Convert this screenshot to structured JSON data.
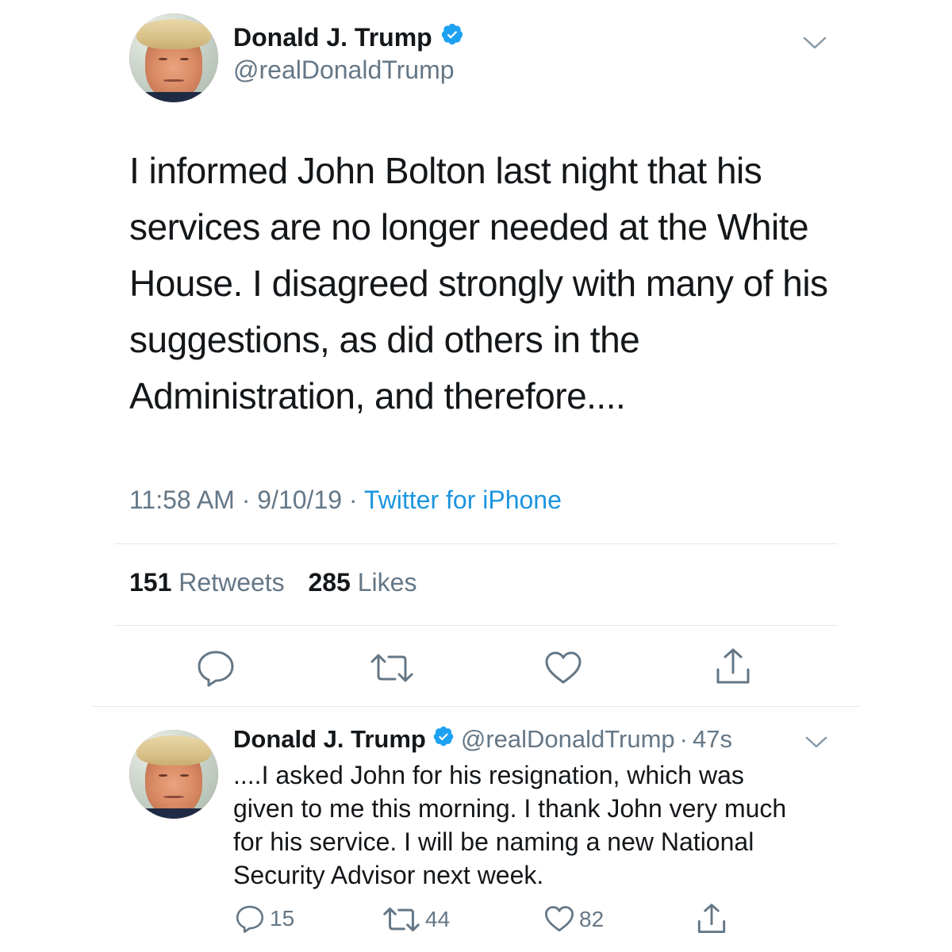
{
  "main_tweet": {
    "author": {
      "display_name": "Donald J. Trump",
      "handle": "@realDonaldTrump",
      "verified": true,
      "avatar": "avatar"
    },
    "text_lines": [
      "I informed John Bolton last night that his",
      "services are no longer needed at the White",
      "House. I disagreed strongly with many of his",
      "suggestions, as did others in the",
      "Administration, and therefore...."
    ],
    "time": "11:58 AM",
    "separator": "·",
    "date": "9/10/19",
    "source": "Twitter for iPhone",
    "retweets_count": "151",
    "retweets_label": "Retweets",
    "likes_count": "285",
    "likes_label": "Likes",
    "icons": {
      "reply": "reply-icon",
      "retweet": "retweet-icon",
      "like": "heart-icon",
      "share": "share-icon",
      "menu": "chevron-down-icon",
      "verified": "verified-badge-icon"
    }
  },
  "reply_tweet": {
    "author": {
      "display_name": "Donald J. Trump",
      "handle": "@realDonaldTrump",
      "verified": true
    },
    "separator": "·",
    "time_ago": "47s",
    "text_lines": [
      "....I asked John for his resignation, which was",
      "given to me this morning. I thank John very much",
      "for his service. I will be naming a new National",
      "Security Advisor next week."
    ],
    "reply_count": "15",
    "retweet_count": "44",
    "like_count": "82"
  },
  "colors": {
    "text": "#14171a",
    "secondary": "#657786",
    "link": "#1b95e0",
    "verified": "#1da1f2",
    "divider": "#e1e8ed"
  }
}
